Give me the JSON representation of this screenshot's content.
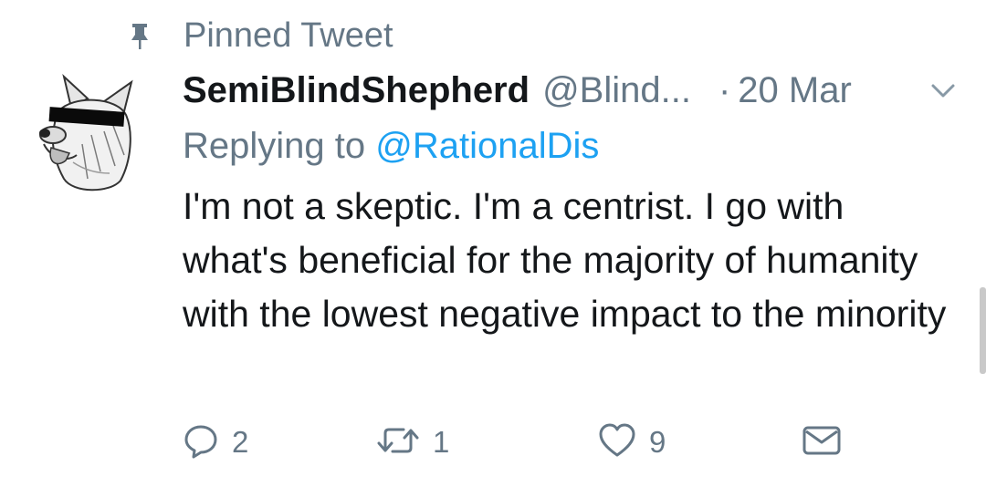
{
  "pinned": {
    "label": "Pinned Tweet",
    "icon": "pin-icon"
  },
  "tweet": {
    "author_name": "SemiBlindShepherd",
    "author_handle": "@Blind...",
    "separator": "·",
    "timestamp": "20 Mar",
    "reply_prefix": "Replying to",
    "reply_to": "@RationalDis",
    "text": "I'm not a skeptic. I'm a centrist. I go with what's beneficial for the majority of humanity with the lowest negative impact to the minority"
  },
  "actions": {
    "reply_count": "2",
    "retweet_count": "1",
    "like_count": "9"
  },
  "colors": {
    "secondary_text": "#657786",
    "primary_text": "#14171a",
    "link": "#1da1f2"
  }
}
